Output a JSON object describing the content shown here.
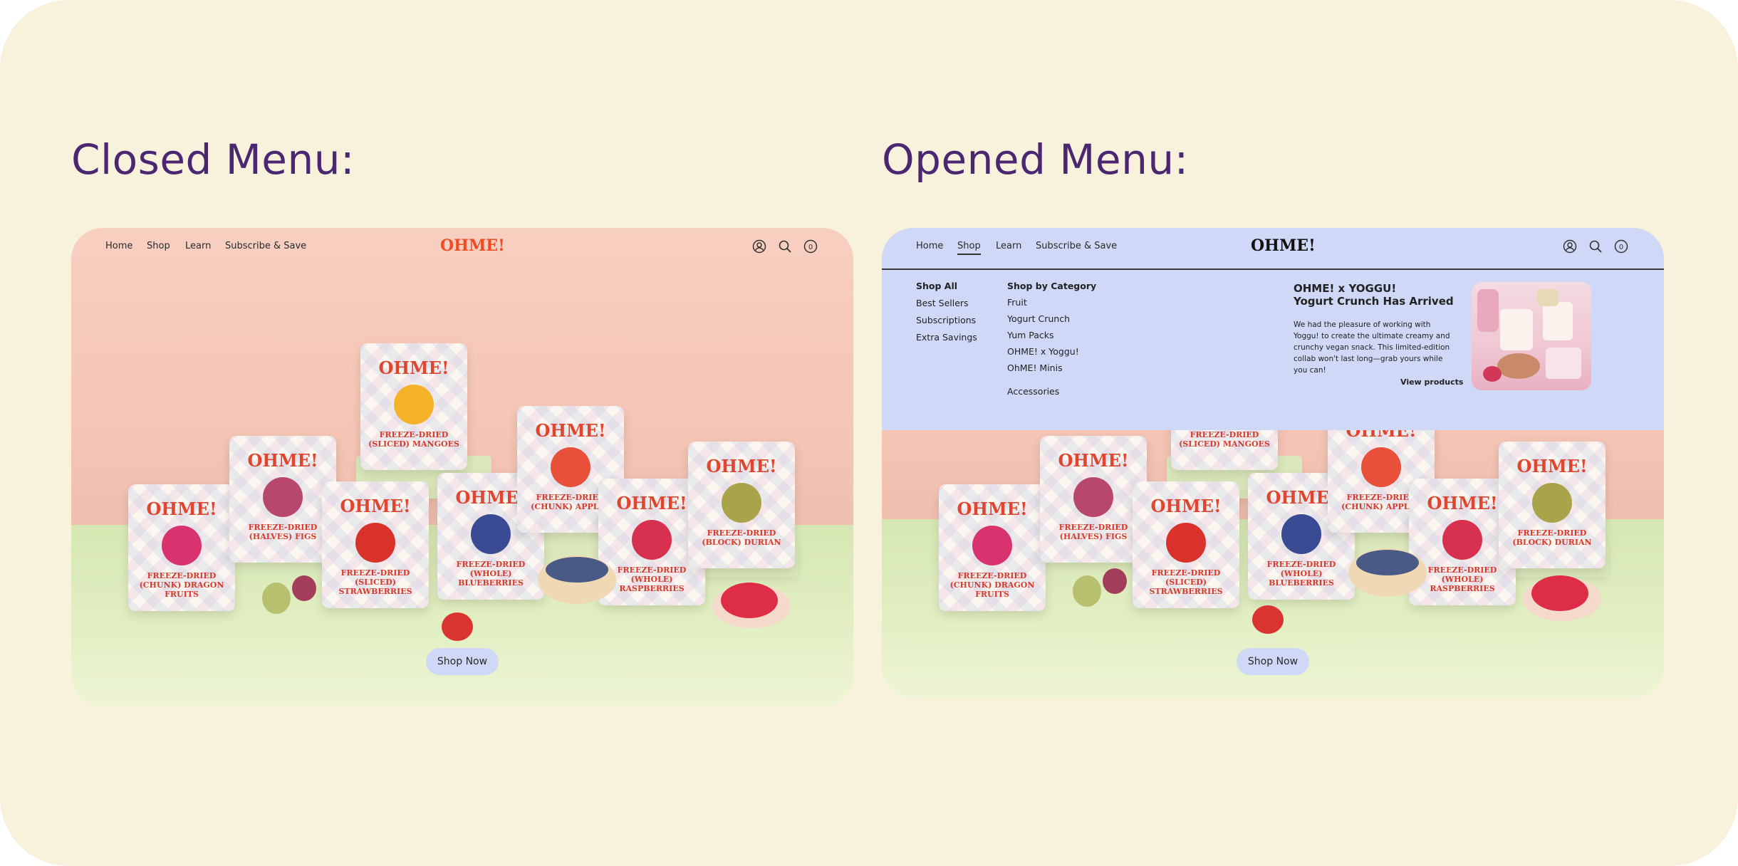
{
  "titles": {
    "closed": "Closed Menu:",
    "opened": "Opened Menu:"
  },
  "nav": {
    "items": [
      "Home",
      "Shop",
      "Learn",
      "Subscribe & Save"
    ],
    "brand": "OHME!",
    "cart_count": "0",
    "icons": [
      "account-icon",
      "search-icon",
      "cart-icon"
    ]
  },
  "hero": {
    "cta": "Shop Now",
    "bags": [
      {
        "logo": "OHME!",
        "name": "FREEZE-DRIED (CHUNK) DRAGON FRUITS",
        "fruit_color": "#d8326f"
      },
      {
        "logo": "OHME!",
        "name": "FREEZE-DRIED (HALVES) FIGS",
        "fruit_color": "#b8476d"
      },
      {
        "logo": "OHME!",
        "name": "FREEZE-DRIED (SLICED) MANGOES",
        "fruit_color": "#f3b227"
      },
      {
        "logo": "OHME!",
        "name": "FREEZE-DRIED (SLICED) STRAWBERRIES",
        "fruit_color": "#d9322b"
      },
      {
        "logo": "OHME!",
        "name": "FREEZE-DRIED (WHOLE) BLUEBERRIES",
        "fruit_color": "#3a4a93"
      },
      {
        "logo": "OHME!",
        "name": "FREEZE-DRIED (CHUNK) APPLES",
        "fruit_color": "#e8503a"
      },
      {
        "logo": "OHME!",
        "name": "FREEZE-DRIED (WHOLE) RASPBERRIES",
        "fruit_color": "#d8304f"
      },
      {
        "logo": "OHME!",
        "name": "FREEZE-DRIED (BLOCK) DURIAN",
        "fruit_color": "#a9a34a"
      }
    ]
  },
  "mega_menu": {
    "col1": [
      "Shop All",
      "Best Sellers",
      "Subscriptions",
      "Extra Savings"
    ],
    "col2_head": "Shop by Category",
    "col2": [
      "Fruit",
      "Yogurt Crunch",
      "Yum Packs",
      "OHME! x Yoggu!",
      "OhME! Minis"
    ],
    "col2_extra": "Accessories",
    "promo": {
      "title_line1": "OHME! x YOGGU!",
      "title_line2": "Yogurt Crunch Has Arrived",
      "body": "We had the pleasure of working with Yoggu! to create the ultimate creamy and crunchy vegan snack. This limited-edition collab won't last long—grab yours while you can!",
      "link": "View products"
    }
  },
  "colors": {
    "background": "#f8f2dc",
    "title": "#4a2770",
    "menu_bg": "#cfd8f7",
    "brand_orange": "#f04a1e",
    "wall_pink": "#f6c6b6",
    "floor_green": "#d6e7b2"
  }
}
